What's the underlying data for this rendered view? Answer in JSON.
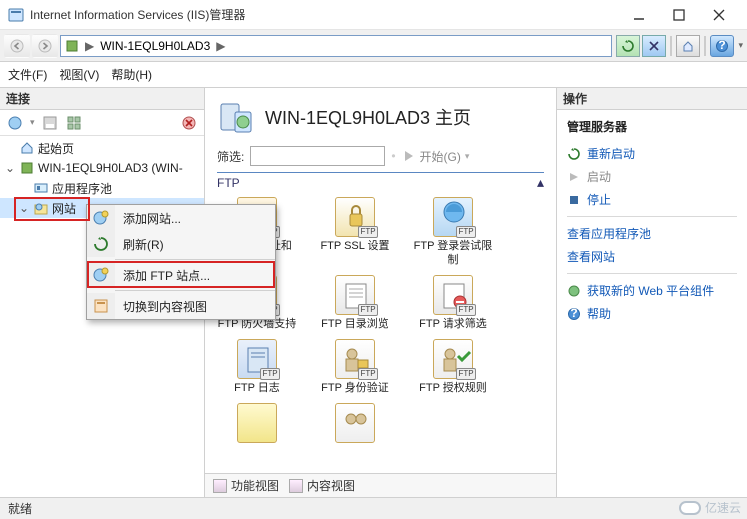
{
  "window": {
    "title": "Internet Information Services (IIS)管理器"
  },
  "address": {
    "host": "WIN-1EQL9H0LAD3",
    "arrow": "▶"
  },
  "menu": {
    "file": "文件(F)",
    "view": "视图(V)",
    "help": "帮助(H)"
  },
  "connections": {
    "title": "连接",
    "start_page": "起始页",
    "server": "WIN-1EQL9H0LAD3 (WIN-",
    "app_pools": "应用程序池",
    "sites": "网站"
  },
  "context_menu": {
    "add_site": "添加网站...",
    "refresh": "刷新(R)",
    "add_ftp": "添加 FTP 站点...",
    "switch_view": "切换到内容视图"
  },
  "page": {
    "heading": "WIN-1EQL9H0LAD3 主页",
    "filter_label": "筛选:",
    "filter_value": "",
    "start_label": "开始(G)",
    "group_label": "FTP"
  },
  "features": {
    "badge": "FTP",
    "r1c1": "FTP IP 地址和域限制",
    "r1c2": "FTP SSL 设置",
    "r1c3": "FTP 登录尝试限制",
    "r2c1": "FTP 防火墙支持",
    "r2c2": "FTP 目录浏览",
    "r2c3": "FTP 请求筛选",
    "r3c1": "FTP 日志",
    "r3c2": "FTP 身份验证",
    "r3c3": "FTP 授权规则"
  },
  "viewtabs": {
    "features": "功能视图",
    "content": "内容视图"
  },
  "actions": {
    "title": "操作",
    "manage": "管理服务器",
    "restart": "重新启动",
    "start": "启动",
    "stop": "停止",
    "view_pools": "查看应用程序池",
    "view_sites": "查看网站",
    "get_webpi": "获取新的 Web 平台组件",
    "help": "帮助"
  },
  "status": {
    "ready": "就绪"
  },
  "watermark": {
    "text": "亿速云"
  }
}
